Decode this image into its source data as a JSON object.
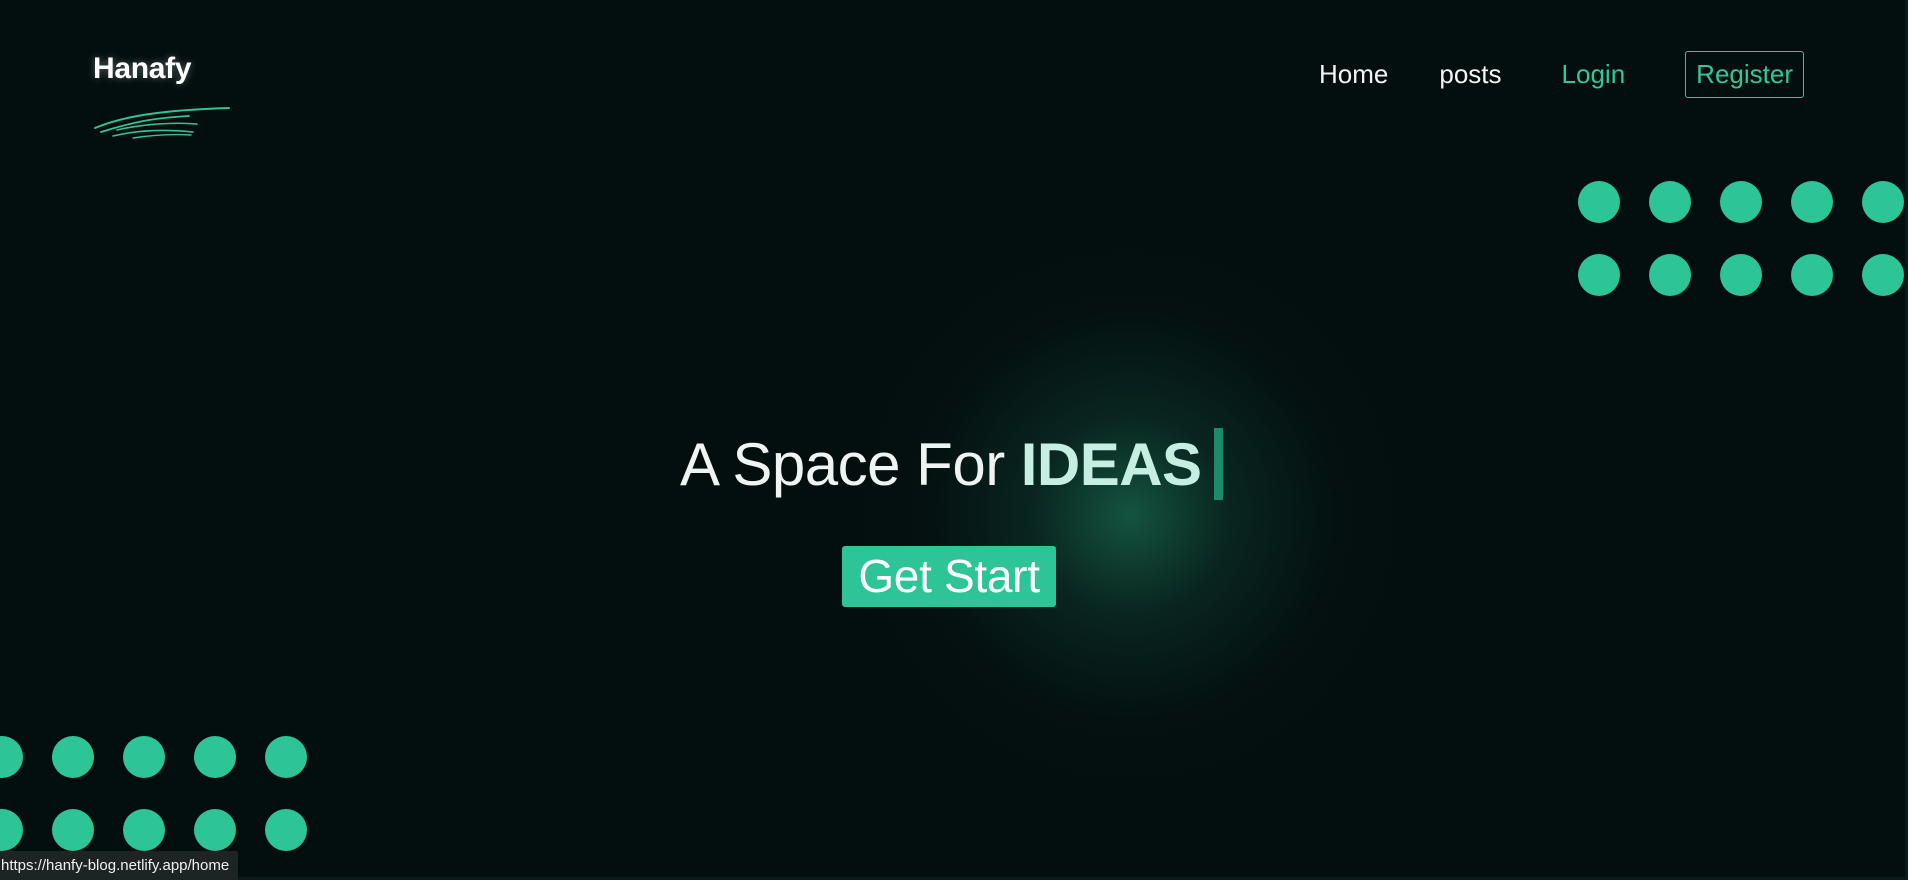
{
  "brand": {
    "name": "Hanafy",
    "accent_color": "#2dc497",
    "background_color": "#030e0e"
  },
  "nav": {
    "home": "Home",
    "posts": "posts",
    "login": "Login",
    "register": "Register"
  },
  "hero": {
    "prefix": "A Space For",
    "highlight": "IDEAS",
    "cta_label": "Get Start"
  },
  "status_bar": {
    "url": "https://hanfy-blog.netlify.app/home"
  }
}
